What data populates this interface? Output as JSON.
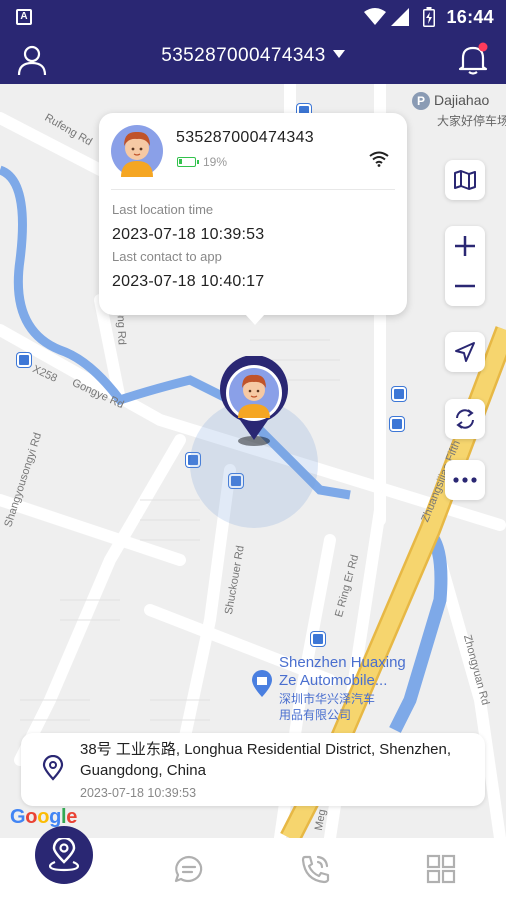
{
  "status_bar": {
    "left_icon": "A",
    "time": "16:44",
    "icons": [
      "wifi-icon",
      "signal-icon",
      "battery-icon"
    ]
  },
  "header": {
    "device_id": "535287000474343",
    "user_icon": "user-icon",
    "bell_icon": "bell-icon",
    "has_notification_dot": true
  },
  "popup": {
    "device_id": "535287000474343",
    "battery_percent": "19%",
    "battery_level": 0.19,
    "connection_icon": "wifi-icon",
    "last_location_label": "Last location time",
    "last_location_value": "2023-07-18 10:39:53",
    "last_contact_label": "Last contact to app",
    "last_contact_value": "2023-07-18 10:40:17"
  },
  "map": {
    "labels": {
      "rufeng": "Rufeng Rd",
      "dajiahao_en": "Dajiahao",
      "dajiahao_cn": "大家好停车场",
      "x258": "X258",
      "gongye": "Gongye Rd",
      "shangyousongyi": "Shangyousongyi Rd",
      "longlong": "long Rd",
      "shuckouer": "Shuckouer Rd",
      "e_ring": "E Ring Er Rd",
      "zhuangsijiao": "Zhuangsijiao Fifth Way",
      "zhongyuan": "Zhongyuan Rd",
      "meg": "Meg",
      "poi_en_1": "Shenzhen Huaxing",
      "poi_en_2": "Ze Automobile...",
      "poi_cn_1": "深圳市华兴泽汽车",
      "poi_cn_2": "用品有限公司"
    },
    "controls": [
      "map-layers-icon",
      "zoom-in-icon",
      "zoom-out-icon",
      "locate-me-icon",
      "refresh-icon",
      "more-icon"
    ],
    "attribution": "Google"
  },
  "address": {
    "text": "38号 工业东路, Longhua Residential District, Shenzhen, Guangdong, China",
    "time": "2023-07-18 10:39:53"
  },
  "bottom_nav": {
    "items": [
      {
        "name": "location",
        "icon": "location-pin-icon",
        "active": true
      },
      {
        "name": "chat",
        "icon": "chat-icon",
        "active": false
      },
      {
        "name": "call",
        "icon": "phone-icon",
        "active": false
      },
      {
        "name": "apps",
        "icon": "grid-icon",
        "active": false
      }
    ]
  },
  "colors": {
    "primary": "#2a2773",
    "battery": "#33c24d",
    "water": "#7ea9e8",
    "highway": "#f2c94c",
    "poi_blue": "#4a6fcf"
  }
}
